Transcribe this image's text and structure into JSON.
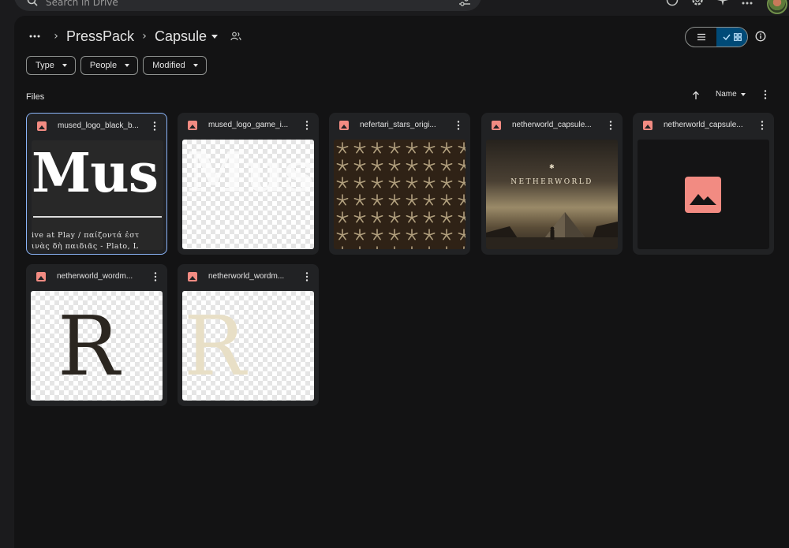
{
  "search": {
    "placeholder": "Search in Drive"
  },
  "breadcrumb": {
    "parent": "PressPack",
    "current": "Capsule"
  },
  "filters": {
    "type": "Type",
    "people": "People",
    "modified": "Modified"
  },
  "files_heading": "Files",
  "sort": {
    "label": "Name"
  },
  "files": [
    {
      "name": "mused_logo_black_b..."
    },
    {
      "name": "mused_logo_game_i..."
    },
    {
      "name": "nefertari_stars_origi..."
    },
    {
      "name": "netherworld_capsule..."
    },
    {
      "name": "netherworld_capsule..."
    },
    {
      "name": "netherworld_wordm..."
    },
    {
      "name": "netherworld_wordm..."
    }
  ],
  "thumbs": {
    "logo_wordmark": "Mus",
    "logo_line1": "ive at Play / παίζοντά ἐστ",
    "logo_line2": "ινὰς δὴ παιδιᾶς - Plato, L",
    "netherworld_title": "NETHERWORLD",
    "wordmark_letter": "R"
  },
  "colors": {
    "panel": "#131314",
    "card": "#212224",
    "accent": "#8ab4f8",
    "image_icon": "#f28b82",
    "wordmark_dark": "#2b2620",
    "wordmark_cream": "#e8dfc6"
  },
  "icons": {
    "search": "search-icon",
    "tune": "tune-icon",
    "list_view": "list-view-icon",
    "grid_view": "grid-view-icon",
    "info": "info-icon",
    "share": "people-icon",
    "sort": "arrow-up-icon",
    "more": "more-vert-icon"
  }
}
